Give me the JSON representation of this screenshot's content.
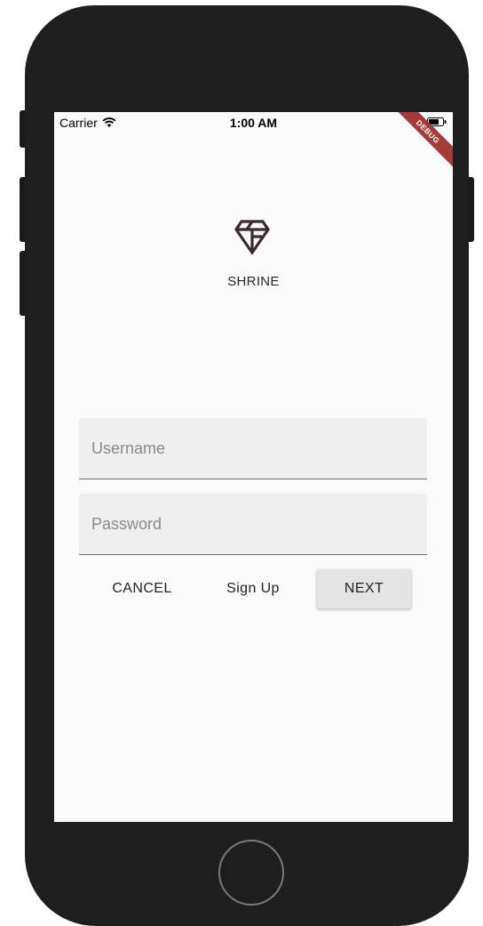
{
  "status_bar": {
    "carrier": "Carrier",
    "time": "1:00 AM"
  },
  "debug_banner": {
    "label": "DEBUG"
  },
  "app": {
    "name": "SHRINE"
  },
  "form": {
    "username": {
      "placeholder": "Username",
      "value": ""
    },
    "password": {
      "placeholder": "Password",
      "value": ""
    }
  },
  "buttons": {
    "cancel": "CANCEL",
    "signup": "Sign Up",
    "next": "NEXT"
  },
  "colors": {
    "frame": "#1e1e1e",
    "screen_bg": "#fafafa",
    "field_bg": "#efefef",
    "debug_banner": "#a53a3a",
    "logo": "#3a2a2c"
  },
  "icons": [
    "wifi-icon",
    "battery-icon",
    "shrine-logo-icon"
  ]
}
